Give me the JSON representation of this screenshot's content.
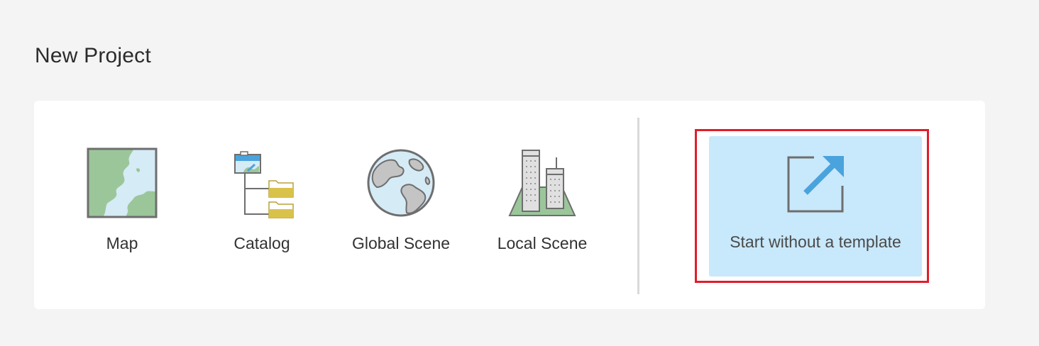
{
  "page": {
    "title": "New Project"
  },
  "templates": [
    {
      "label": "Map",
      "icon": "map-icon"
    },
    {
      "label": "Catalog",
      "icon": "catalog-icon"
    },
    {
      "label": "Global Scene",
      "icon": "globe-icon"
    },
    {
      "label": "Local Scene",
      "icon": "city-buildings-icon"
    }
  ],
  "blank_template": {
    "label": "Start without a template",
    "icon": "open-external-arrow-icon",
    "selected": true
  },
  "colors": {
    "background": "#f4f4f4",
    "panel": "#ffffff",
    "selected_tile": "#c8e8fb",
    "highlight_border": "#e21c2a",
    "accent_blue": "#4aa3dc",
    "map_land": "#9bc69a",
    "map_water": "#d5ebf6",
    "folder_yellow": "#d9c24a"
  }
}
